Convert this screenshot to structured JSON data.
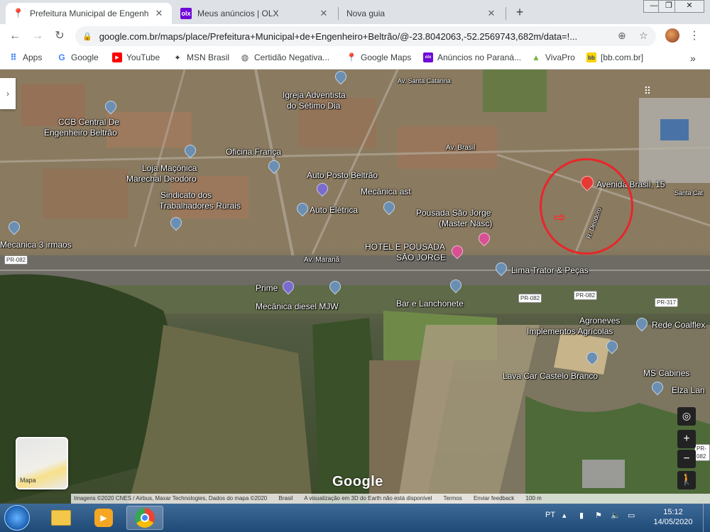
{
  "browser": {
    "tabs": [
      {
        "title": "Prefeitura Municipal de Engenhe",
        "favicon": "google-maps-icon",
        "active": true
      },
      {
        "title": "Meus anúncios | OLX",
        "favicon": "olx-icon",
        "active": false
      },
      {
        "title": "Nova guia",
        "favicon": "",
        "active": false
      }
    ],
    "new_tab": "+",
    "window_controls": {
      "minimize": "—",
      "maximize": "❐",
      "close": "✕"
    },
    "url": "google.com.br/maps/place/Prefeitura+Municipal+de+Engenheiro+Beltrão/@-23.8042063,-52.2569743,682m/data=!..."
  },
  "bookmarks": [
    {
      "label": "Apps",
      "icon": "apps-grid-icon"
    },
    {
      "label": "Google",
      "icon": "google-icon"
    },
    {
      "label": "YouTube",
      "icon": "youtube-icon"
    },
    {
      "label": "MSN Brasil",
      "icon": "msn-icon"
    },
    {
      "label": "Certidão Negativa...",
      "icon": "globe-icon"
    },
    {
      "label": "Google Maps",
      "icon": "google-maps-icon"
    },
    {
      "label": "Anúncios no Paraná...",
      "icon": "olx-icon"
    },
    {
      "label": "VivaPro",
      "icon": "vivapro-icon"
    },
    {
      "label": "[bb.com.br]",
      "icon": "bb-icon"
    }
  ],
  "bookmarks_more": "»",
  "map": {
    "labels": {
      "l1": "Igreja Adventista",
      "l2": "do Sétimo Dia",
      "l3": "CCB Central De",
      "l4": "Engenheiro Beltrão",
      "l5": "Oficina França",
      "l6": "Loja Maçônica",
      "l7": "Marechal Deodoro",
      "l8": "Auto Posto Beltrão",
      "l9": "Sindicato dos",
      "l10": "Trabalhadores Rurais",
      "l11": "Auto Elétrica",
      "l12": "Pousada São Jorge",
      "l13": "(Master Nasc)",
      "l14": "HOTEL E POUSADA",
      "l15": "SÃO JORGE",
      "l16": "Lima Trator & Peças",
      "l17": "Mecanica 3 irmaos",
      "l18": "Prime",
      "l19": "Mecânica diesel MJW",
      "l20": "Bar e Lanchonete",
      "l21": "Agroneves",
      "l22": "Implementos Agrícolas",
      "l23": "Rede Coalflex",
      "l24": "Lava Car Castelo Branco",
      "l25": "MS Cabines",
      "l26": "Elza Lan",
      "l27": "Avenida Brasil, 15",
      "l28": "Mecânica ast",
      "l29": "Av. Maranã",
      "l30": "Av. Brasil",
      "l31": "R. Deodoro",
      "l32": "Santa Cat",
      "l33": "Av. Santa Catarina"
    },
    "shields": {
      "s1": "PR-082",
      "s2": "PR-082",
      "s3": "PR-082",
      "s4": "PR-317",
      "s5": "PR-082"
    },
    "side_toggle": "›",
    "layers_label": "Mapa",
    "zoom_in": "+",
    "zoom_out": "−",
    "logo": "Google",
    "attribution": [
      "Imagens ©2020 CNES / Airbus, Maxar Technologies, Dados do mapa ©2020",
      "Brasil",
      "A visualização em 3D do Earth não está disponível",
      "Termos",
      "Enviar feedback",
      "100 m"
    ]
  },
  "taskbar": {
    "tray_lang": "PT",
    "time": "15:12",
    "date": "14/05/2020"
  },
  "colors": {
    "accent_red": "#e8262a",
    "taskbar": "#1f4a78",
    "tab_strip": "#dee1e6"
  }
}
